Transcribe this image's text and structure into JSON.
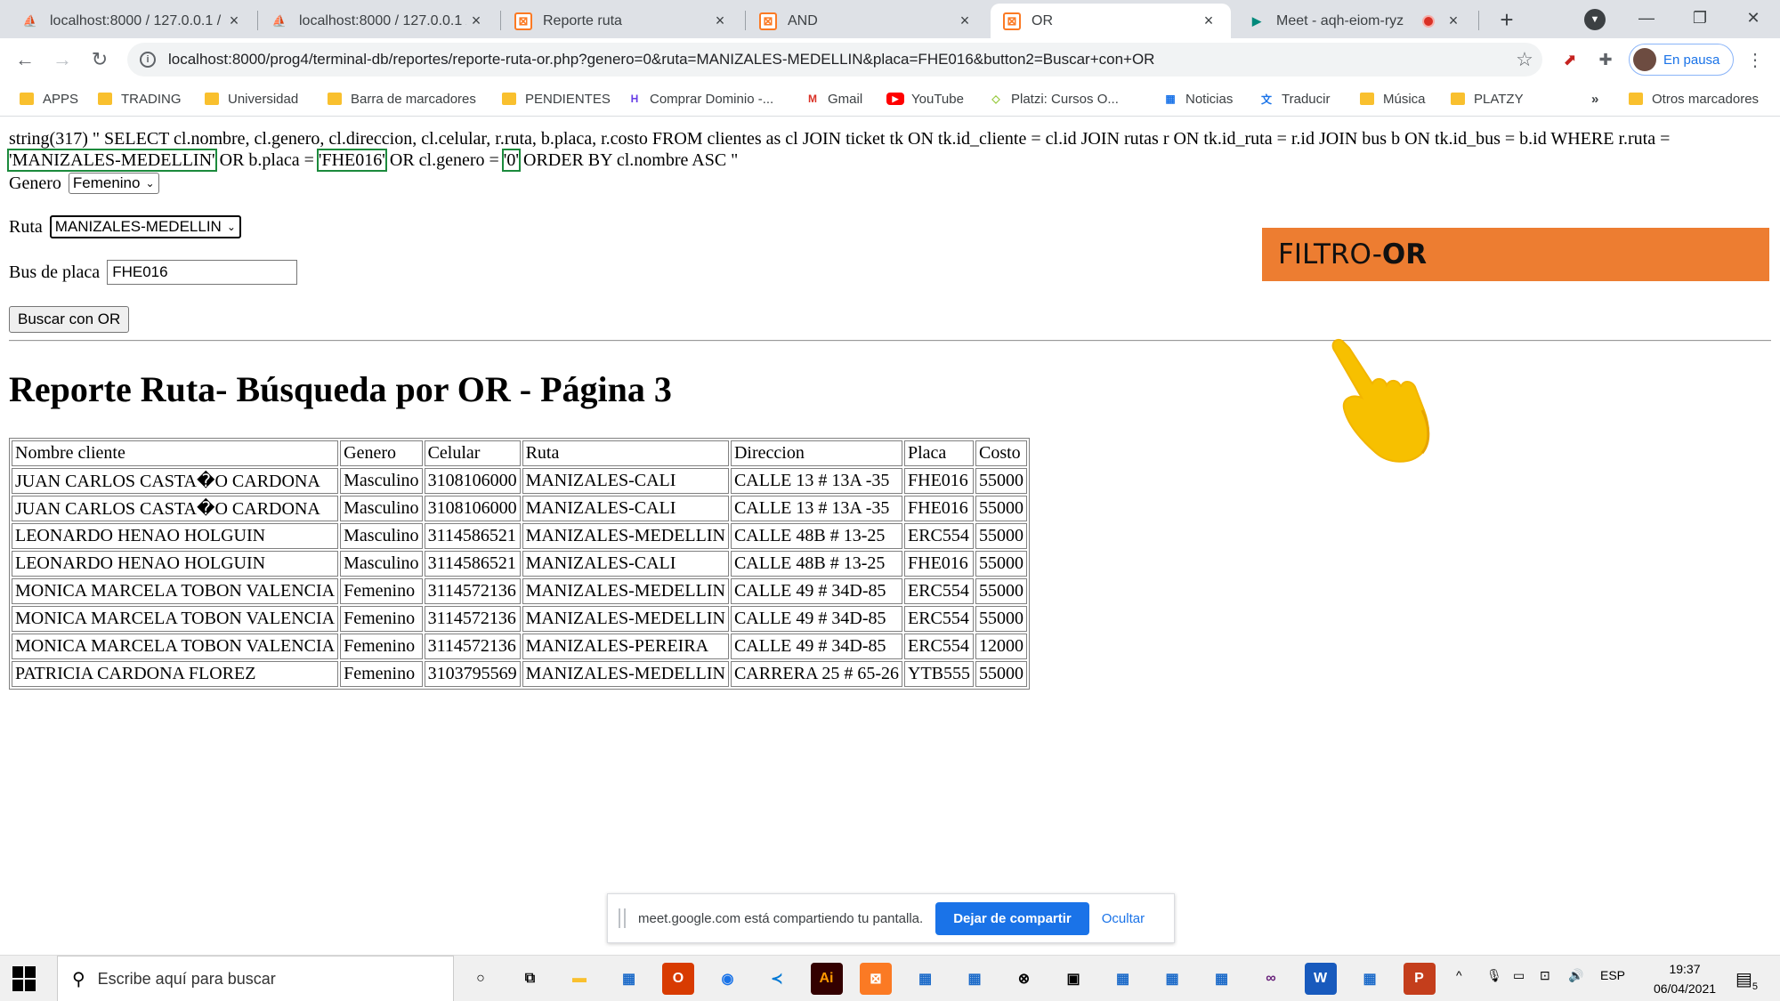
{
  "browser": {
    "tabs": [
      {
        "title": "localhost:8000 / 127.0.0.1 / ",
        "icon": "phpmyadmin-icon"
      },
      {
        "title": "localhost:8000 / 127.0.0.1 / ",
        "icon": "phpmyadmin-icon"
      },
      {
        "title": "Reporte ruta",
        "icon": "xampp-icon"
      },
      {
        "title": "AND",
        "icon": "xampp-icon"
      },
      {
        "title": "OR",
        "icon": "xampp-icon",
        "active": true
      },
      {
        "title": "Meet - aqh-eiom-ryz",
        "icon": "meet-icon",
        "recording": true
      }
    ],
    "url": "localhost:8000/prog4/terminal-db/reportes/reporte-ruta-or.php?genero=0&ruta=MANIZALES-MEDELLIN&placa=FHE016&button2=Buscar+con+OR",
    "profile_label": "En pausa",
    "bookmarks": [
      {
        "label": "APPS",
        "icon": "folder-icon"
      },
      {
        "label": "TRADING",
        "icon": "folder-icon"
      },
      {
        "label": "Universidad",
        "icon": "folder-icon"
      },
      {
        "label": "Barra de marcadores",
        "icon": "folder-icon"
      },
      {
        "label": "PENDIENTES",
        "icon": "folder-icon"
      },
      {
        "label": "Comprar Dominio -...",
        "icon": "hostinger-icon"
      },
      {
        "label": "Gmail",
        "icon": "gmail-icon"
      },
      {
        "label": "YouTube",
        "icon": "youtube-icon"
      },
      {
        "label": "Platzi: Cursos O...",
        "icon": "platzi-icon"
      },
      {
        "label": "Noticias",
        "icon": "news-icon"
      },
      {
        "label": "Traducir",
        "icon": "translate-icon"
      },
      {
        "label": "Música",
        "icon": "folder-icon"
      },
      {
        "label": "PLATZY",
        "icon": "folder-icon"
      },
      {
        "label": "Otros marcadores",
        "icon": "folder-icon"
      }
    ],
    "more_bookmarks": "»"
  },
  "page": {
    "sql": {
      "prefix": "string(317) \" SELECT cl.nombre, cl.genero, cl.direccion, cl.celular, r.ruta, b.placa, r.costo FROM clientes as cl JOIN ticket tk ON tk.id_cliente = cl.id JOIN rutas r ON tk.id_ruta = r.id JOIN bus b ON tk.id_bus = b.id WHERE r.ruta =",
      "val_ruta": "'MANIZALES-MEDELLIN'",
      "mid1": " OR b.placa = ",
      "val_placa": "'FHE016'",
      "mid2": " OR cl.genero = ",
      "val_genero": "'0'",
      "suffix": " ORDER BY cl.nombre ASC \""
    },
    "form": {
      "genero_label": "Genero",
      "genero_value": "Femenino",
      "ruta_label": "Ruta",
      "ruta_value": "MANIZALES-MEDELLIN",
      "placa_label": "Bus de placa",
      "placa_value": "FHE016",
      "submit_label": "Buscar con OR"
    },
    "title": "Reporte Ruta- Búsqueda por OR - Página 3",
    "table": {
      "headers": [
        "Nombre cliente",
        "Genero",
        "Celular",
        "Ruta",
        "Direccion",
        "Placa",
        "Costo"
      ],
      "rows": [
        [
          "JUAN CARLOS CASTA�O CARDONA",
          "Masculino",
          "3108106000",
          "MANIZALES-CALI",
          "CALLE 13 # 13A -35",
          "FHE016",
          "55000"
        ],
        [
          "JUAN CARLOS CASTA�O CARDONA",
          "Masculino",
          "3108106000",
          "MANIZALES-CALI",
          "CALLE 13 # 13A -35",
          "FHE016",
          "55000"
        ],
        [
          "LEONARDO HENAO HOLGUIN",
          "Masculino",
          "3114586521",
          "MANIZALES-MEDELLIN",
          "CALLE 48B # 13-25",
          "ERC554",
          "55000"
        ],
        [
          "LEONARDO HENAO HOLGUIN",
          "Masculino",
          "3114586521",
          "MANIZALES-CALI",
          "CALLE 48B # 13-25",
          "FHE016",
          "55000"
        ],
        [
          "MONICA MARCELA TOBON VALENCIA",
          "Femenino",
          "3114572136",
          "MANIZALES-MEDELLIN",
          "CALLE 49 # 34D-85",
          "ERC554",
          "55000"
        ],
        [
          "MONICA MARCELA TOBON VALENCIA",
          "Femenino",
          "3114572136",
          "MANIZALES-MEDELLIN",
          "CALLE 49 # 34D-85",
          "ERC554",
          "55000"
        ],
        [
          "MONICA MARCELA TOBON VALENCIA",
          "Femenino",
          "3114572136",
          "MANIZALES-PEREIRA",
          "CALLE 49 # 34D-85",
          "ERC554",
          "12000"
        ],
        [
          "PATRICIA CARDONA FLOREZ",
          "Femenino",
          "3103795569",
          "MANIZALES-MEDELLIN",
          "CARRERA 25 # 65-26",
          "YTB555",
          "55000"
        ]
      ]
    },
    "overlay": {
      "filtro_prefix": "FILTRO-",
      "filtro_bold": "OR",
      "filtro_color": "#ed7d31",
      "hand_icon": "pointing-hand-icon"
    }
  },
  "sharebar": {
    "message": "meet.google.com está compartiendo tu pantalla.",
    "stop_label": "Dejar de compartir",
    "hide_label": "Ocultar"
  },
  "taskbar": {
    "search_placeholder": "Escribe aquí para buscar",
    "lang": "ESP",
    "time": "19:37",
    "date": "06/04/2021",
    "notifications": "5",
    "apps": [
      "cortana-icon",
      "task-view-icon",
      "file-explorer-icon",
      "app-icon",
      "office-icon",
      "chrome-icon",
      "vscode-icon",
      "illustrator-icon",
      "xampp-icon",
      "app-icon",
      "app-icon",
      "xbox-icon",
      "store-icon",
      "app-icon",
      "app-icon",
      "app-icon",
      "visual-studio-icon",
      "word-icon",
      "app-icon",
      "powerpoint-icon"
    ]
  }
}
